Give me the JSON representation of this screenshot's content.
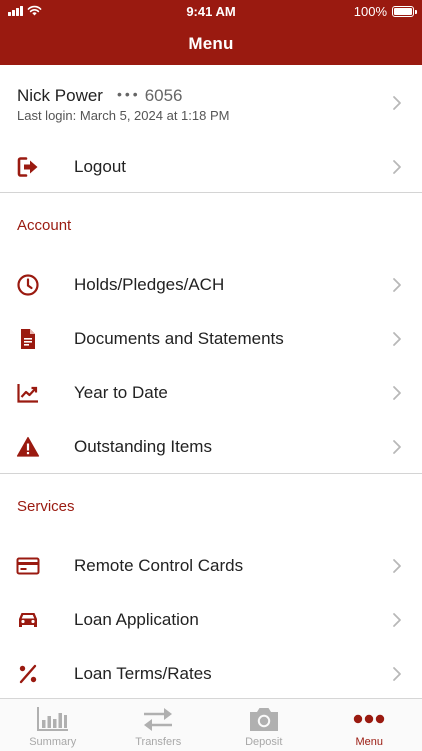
{
  "status_bar": {
    "time": "9:41 AM",
    "battery": "100%"
  },
  "header": {
    "title": "Menu"
  },
  "profile": {
    "name": "Nick Power",
    "masked_dots": "•••",
    "account_suffix": "6056",
    "last_login": "Last login: March 5, 2024 at 1:18 PM"
  },
  "logout": {
    "label": "Logout",
    "icon": "logout-icon"
  },
  "account_section": {
    "heading": "Account",
    "items": [
      {
        "label": "Holds/Pledges/ACH",
        "icon": "clock-icon"
      },
      {
        "label": "Documents and Statements",
        "icon": "document-icon"
      },
      {
        "label": "Year to Date",
        "icon": "trending-chart-icon"
      },
      {
        "label": "Outstanding Items",
        "icon": "warning-icon"
      }
    ]
  },
  "services_section": {
    "heading": "Services",
    "items": [
      {
        "label": "Remote Control Cards",
        "icon": "credit-card-icon"
      },
      {
        "label": "Loan Application",
        "icon": "car-icon"
      },
      {
        "label": "Loan Terms/Rates",
        "icon": "percent-icon"
      }
    ]
  },
  "tabbar": {
    "tabs": [
      {
        "label": "Summary",
        "icon": "bar-chart-icon",
        "active": false
      },
      {
        "label": "Transfers",
        "icon": "transfer-arrows-icon",
        "active": false
      },
      {
        "label": "Deposit",
        "icon": "camera-icon",
        "active": false
      },
      {
        "label": "Menu",
        "icon": "more-dots-icon",
        "active": true
      }
    ]
  },
  "colors": {
    "brand": "#9a1a10",
    "inactive_tab": "#a8a8a8",
    "divider": "#d4d4d4"
  }
}
